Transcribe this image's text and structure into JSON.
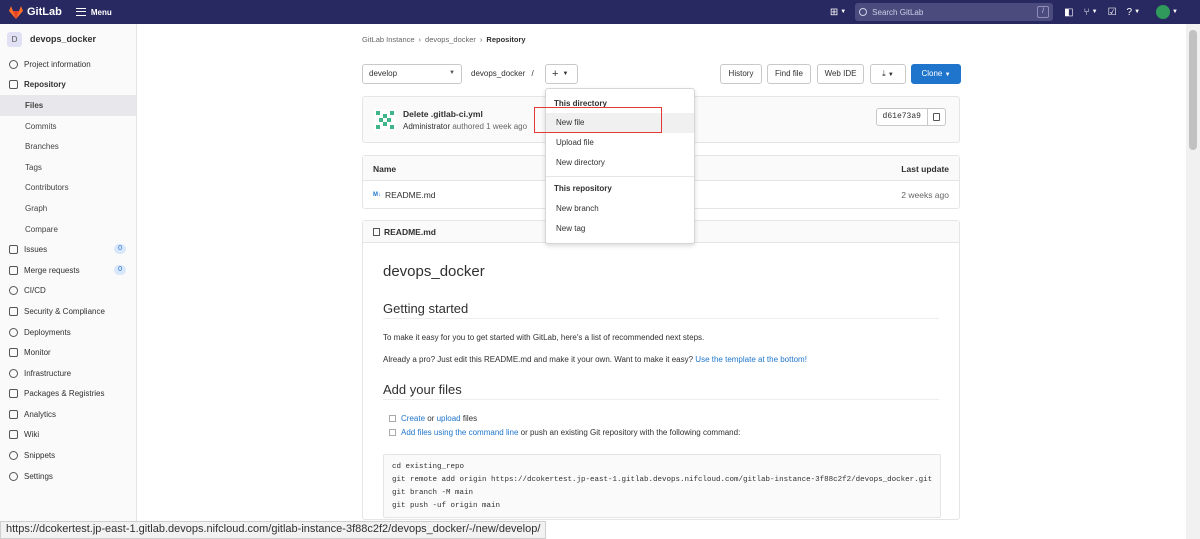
{
  "topbar": {
    "brand": "GitLab",
    "menu_label": "Menu",
    "search_placeholder": "Search GitLab",
    "search_shortcut": "/",
    "bg_color": "#292961"
  },
  "sidebar": {
    "project_initial": "D",
    "project_name": "devops_docker",
    "items": [
      {
        "label": "Project information",
        "icon": "info-icon"
      },
      {
        "label": "Repository",
        "icon": "book-icon"
      },
      {
        "label": "Files"
      },
      {
        "label": "Commits"
      },
      {
        "label": "Branches"
      },
      {
        "label": "Tags"
      },
      {
        "label": "Contributors"
      },
      {
        "label": "Graph"
      },
      {
        "label": "Compare"
      },
      {
        "label": "Issues",
        "icon": "issues-icon",
        "badge": "0"
      },
      {
        "label": "Merge requests",
        "icon": "merge-request-icon",
        "badge": "0"
      },
      {
        "label": "CI/CD",
        "icon": "rocket-icon"
      },
      {
        "label": "Security & Compliance",
        "icon": "shield-icon"
      },
      {
        "label": "Deployments",
        "icon": "deployments-icon"
      },
      {
        "label": "Monitor",
        "icon": "monitor-icon"
      },
      {
        "label": "Infrastructure",
        "icon": "cloud-icon"
      },
      {
        "label": "Packages & Registries",
        "icon": "package-icon"
      },
      {
        "label": "Analytics",
        "icon": "chart-icon"
      },
      {
        "label": "Wiki",
        "icon": "wiki-icon"
      },
      {
        "label": "Snippets",
        "icon": "snippet-icon"
      },
      {
        "label": "Settings",
        "icon": "gear-icon"
      }
    ]
  },
  "breadcrumb": [
    "GitLab Instance",
    "devops_docker",
    "Repository"
  ],
  "toolbar": {
    "branch": "develop",
    "path": "devops_docker",
    "path_sep": "/",
    "add_symbol": "+",
    "history": "History",
    "find_file": "Find file",
    "web_ide": "Web IDE",
    "clone": "Clone"
  },
  "commit": {
    "title": "Delete .gitlab-ci.yml",
    "author": "Administrator",
    "meta": "authored 1 week ago",
    "sha": "d61e73a9"
  },
  "file_tree": {
    "headers": {
      "name": "Name",
      "last_update": "Last update"
    },
    "rows": [
      {
        "name": "README.md",
        "last_update": "2 weeks ago"
      }
    ]
  },
  "readme": {
    "filename": "README.md",
    "title": "devops_docker",
    "h_getting_started": "Getting started",
    "p1": "To make it easy for you to get started with GitLab, here's a list of recommended next steps.",
    "p2_text": "Already a pro? Just edit this README.md and make it your own. Want to make it easy?",
    "p2_link": "Use the template at the bottom!",
    "h_add_files": "Add your files",
    "task1_link1": "Create",
    "task1_or": "or",
    "task1_link2": "upload",
    "task1_rest": "files",
    "task2_link": "Add files using the command line",
    "task2_rest": "or push an existing Git repository with the following command:",
    "code": "cd existing_repo\ngit remote add origin https://dcokertest.jp-east-1.gitlab.devops.nifcloud.com/gitlab-instance-3f88c2f2/devops_docker.git\ngit branch -M main\ngit push -uf origin main"
  },
  "dropdown": {
    "header_dir": "This directory",
    "new_file": "New file",
    "upload_file": "Upload file",
    "new_directory": "New directory",
    "header_repo": "This repository",
    "new_branch": "New branch",
    "new_tag": "New tag"
  },
  "status_url": "https://dcokertest.jp-east-1.gitlab.devops.nifcloud.com/gitlab-instance-3f88c2f2/devops_docker/-/new/develop/"
}
